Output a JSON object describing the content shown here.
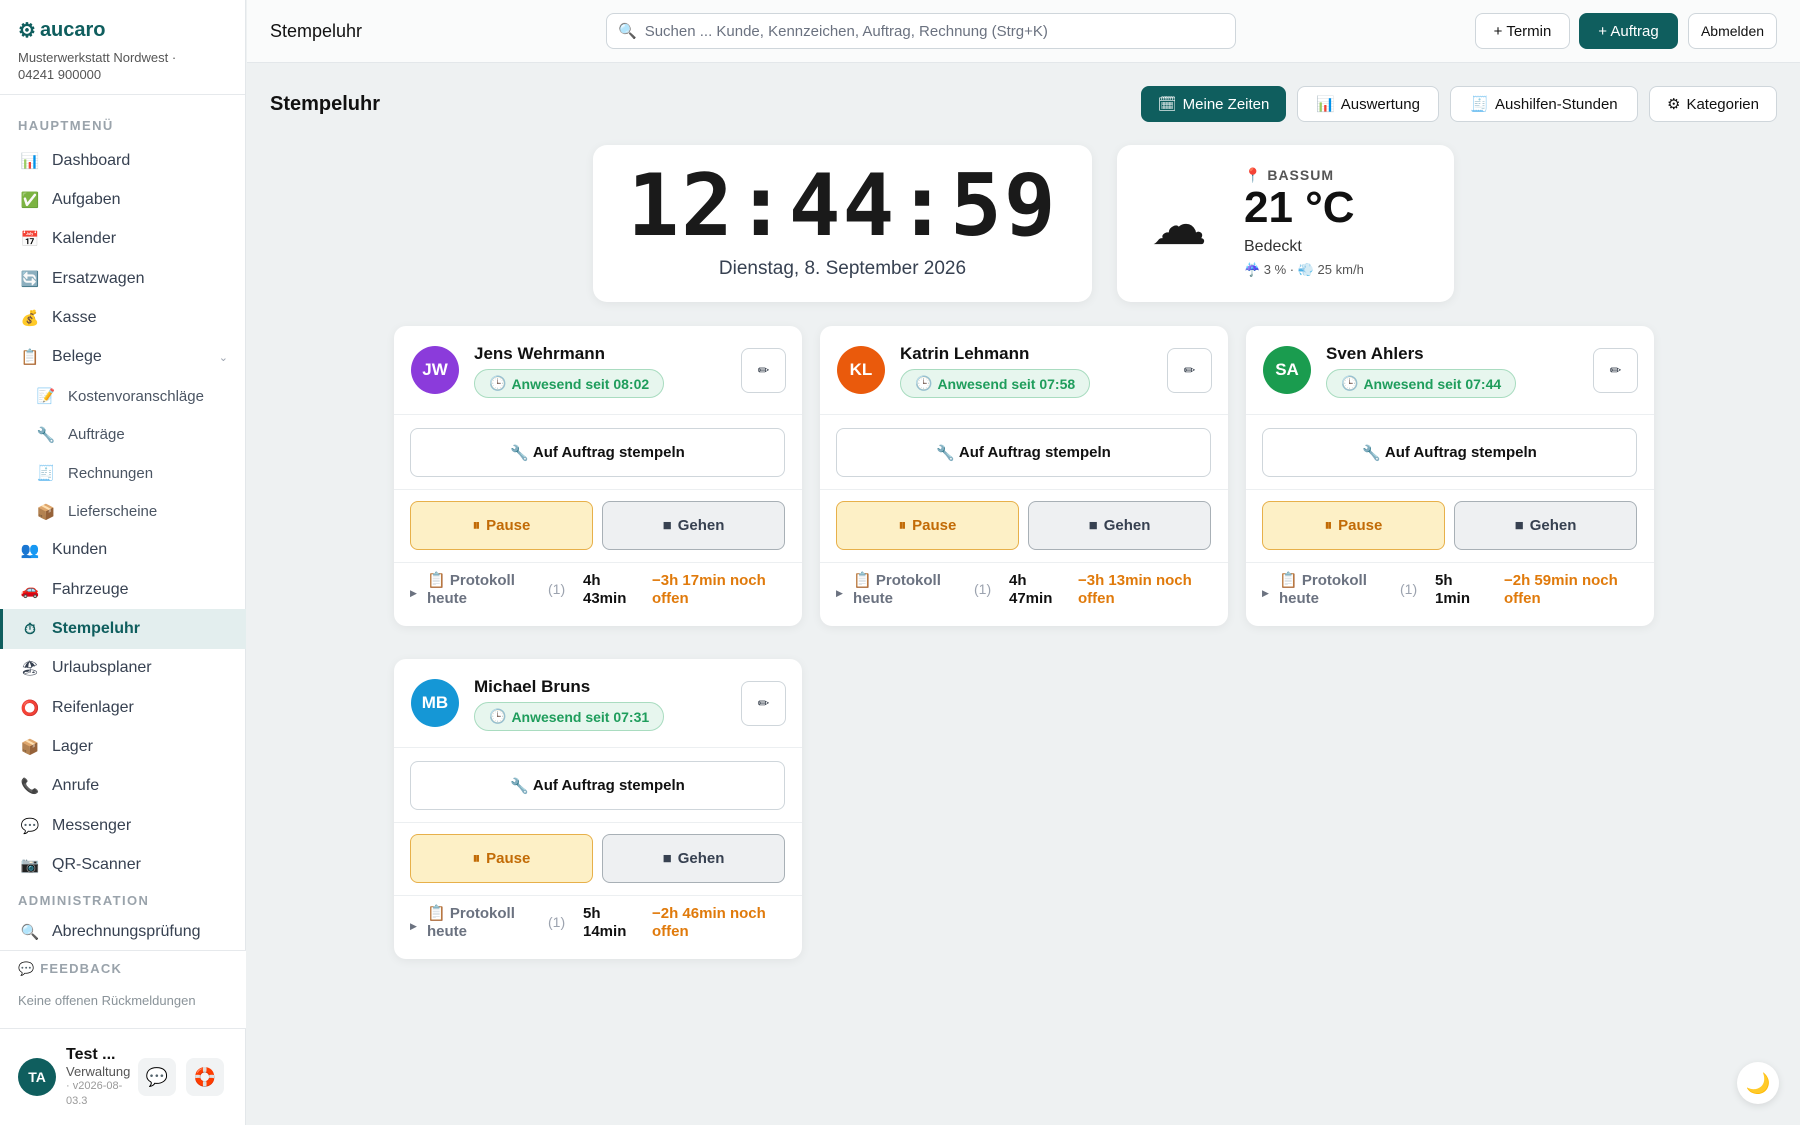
{
  "brand": {
    "name": "aucaro",
    "subtitle": "Musterwerkstatt Nordwest · 04241 900000"
  },
  "sidebar": {
    "section_main": "HAUPTMENÜ",
    "items": [
      {
        "label": "Dashboard",
        "icon": "📊"
      },
      {
        "label": "Aufgaben",
        "icon": "✅"
      },
      {
        "label": "Kalender",
        "icon": "📅"
      },
      {
        "label": "Ersatzwagen",
        "icon": "🔄"
      },
      {
        "label": "Kasse",
        "icon": "💰"
      },
      {
        "label": "Belege",
        "icon": "📋"
      }
    ],
    "sub_items": [
      {
        "label": "Kostenvoranschläge",
        "icon": "📝"
      },
      {
        "label": "Aufträge",
        "icon": "🔧"
      },
      {
        "label": "Rechnungen",
        "icon": "🧾"
      },
      {
        "label": "Lieferscheine",
        "icon": "📦"
      }
    ],
    "items2": [
      {
        "label": "Kunden",
        "icon": "👥"
      },
      {
        "label": "Fahrzeuge",
        "icon": "🚗"
      },
      {
        "label": "Stempeluhr",
        "icon": "⏱"
      },
      {
        "label": "Urlaubsplaner",
        "icon": "🏖"
      },
      {
        "label": "Reifenlager",
        "icon": "⭕"
      },
      {
        "label": "Lager",
        "icon": "📦"
      },
      {
        "label": "Anrufe",
        "icon": "📞"
      },
      {
        "label": "Messenger",
        "icon": "💬"
      },
      {
        "label": "QR-Scanner",
        "icon": "📷"
      }
    ],
    "section_admin": "ADMINISTRATION",
    "admin_items": [
      {
        "label": "Abrechnungsprüfung",
        "icon": "🔍"
      }
    ],
    "feedback_title": "FEEDBACK",
    "feedback_text": "Keine offenen Rückmeldungen",
    "user": {
      "initials": "TA",
      "name": "Test ...",
      "role": "Verwaltung",
      "version": "· v2026-08-03.3"
    }
  },
  "topbar": {
    "title": "Stempeluhr",
    "search_placeholder": "Suchen ... Kunde, Kennzeichen, Auftrag, Rechnung (Strg+K)",
    "btn_termin": "+ Termin",
    "btn_auftrag": "+ Auftrag",
    "btn_logout": "Abmelden"
  },
  "page": {
    "title": "Stempeluhr",
    "buttons": {
      "meine_zeiten": "Meine Zeiten",
      "auswertung": "Auswertung",
      "aushilfen": "Aushilfen-Stunden",
      "kategorien": "Kategorien"
    }
  },
  "clock": {
    "time": "12:44:59",
    "date": "Dienstag, 8. September 2026"
  },
  "weather": {
    "location": "BASSUM",
    "temp": "21 °C",
    "desc": "Bedeckt",
    "extra": "☔ 3 % · 💨 25 km/h"
  },
  "labels": {
    "book": "Auf Auftrag stempeln",
    "pause": "Pause",
    "leave": "Gehen",
    "protocol": "Protokoll heute"
  },
  "employees": [
    {
      "initials": "JW",
      "name": "Jens Wehrmann",
      "color": "#8b3bdb",
      "status": "Anwesend seit 08:02",
      "count": "(1)",
      "hours": "4h 43min",
      "open": "−3h 17min noch offen"
    },
    {
      "initials": "KL",
      "name": "Katrin Lehmann",
      "color": "#ea5a0c",
      "status": "Anwesend seit 07:58",
      "count": "(1)",
      "hours": "4h 47min",
      "open": "−3h 13min noch offen"
    },
    {
      "initials": "SA",
      "name": "Sven Ahlers",
      "color": "#1a9c4f",
      "status": "Anwesend seit 07:44",
      "count": "(1)",
      "hours": "5h 1min",
      "open": "−2h 59min noch offen"
    },
    {
      "initials": "MB",
      "name": "Michael Bruns",
      "color": "#1597d6",
      "status": "Anwesend seit 07:31",
      "count": "(1)",
      "hours": "5h 14min",
      "open": "−2h 46min noch offen"
    }
  ]
}
